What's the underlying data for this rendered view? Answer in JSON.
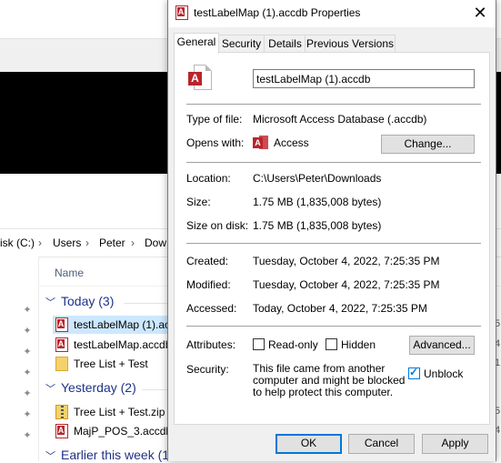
{
  "explorer": {
    "breadcrumb": [
      "isk (C:)",
      "Users",
      "Peter",
      "Dow"
    ],
    "column_header": "Name",
    "groups": [
      {
        "label": "Today (3)"
      },
      {
        "label": "Yesterday (2)"
      },
      {
        "label": "Earlier this week (1"
      }
    ],
    "files": [
      {
        "name": "testLabelMap (1).ac",
        "type": "access",
        "selected": true
      },
      {
        "name": "testLabelMap.accdb",
        "type": "access"
      },
      {
        "name": "Tree List + Test",
        "type": "folder"
      },
      {
        "name": "Tree List + Test.zip",
        "type": "zip"
      },
      {
        "name": "MajP_POS_3.accdb",
        "type": "access"
      }
    ],
    "edge_digits": [
      "5",
      "4",
      "1",
      "5",
      "4"
    ]
  },
  "dialog": {
    "title": "testLabelMap (1).accdb Properties",
    "close_glyph": "✕",
    "tabs": [
      {
        "label": "General",
        "active": true
      },
      {
        "label": "Security"
      },
      {
        "label": "Details"
      },
      {
        "label": "Previous Versions"
      }
    ],
    "general": {
      "file_name": "testLabelMap (1).accdb",
      "type_label": "Type of file:",
      "type_value": "Microsoft Access Database (.accdb)",
      "opens_label": "Opens with:",
      "opens_value": "Access",
      "change_button": "Change...",
      "location_label": "Location:",
      "location_value": "C:\\Users\\Peter\\Downloads",
      "size_label": "Size:",
      "size_value": "1.75 MB (1,835,008 bytes)",
      "size_disk_label": "Size on disk:",
      "size_disk_value": "1.75 MB (1,835,008 bytes)",
      "created_label": "Created:",
      "created_value": "Tuesday, October 4, 2022, 7:25:35 PM",
      "modified_label": "Modified:",
      "modified_value": "Tuesday, October 4, 2022, 7:25:35 PM",
      "accessed_label": "Accessed:",
      "accessed_value": "Today, October 4, 2022, 7:25:35 PM",
      "attributes_label": "Attributes:",
      "readonly_label": "Read-only",
      "readonly_checked": false,
      "hidden_label": "Hidden",
      "hidden_checked": false,
      "advanced_button": "Advanced...",
      "security_label": "Security:",
      "security_text": "This file came from another computer and might be blocked to help protect this computer.",
      "unblock_label": "Unblock",
      "unblock_checked": true
    },
    "buttons": {
      "ok": "OK",
      "cancel": "Cancel",
      "apply": "Apply"
    }
  },
  "colors": {
    "access_red": "#b9252c",
    "group_blue": "#1e3287",
    "selection": "#cce8ff",
    "focus_blue": "#0078d7"
  }
}
